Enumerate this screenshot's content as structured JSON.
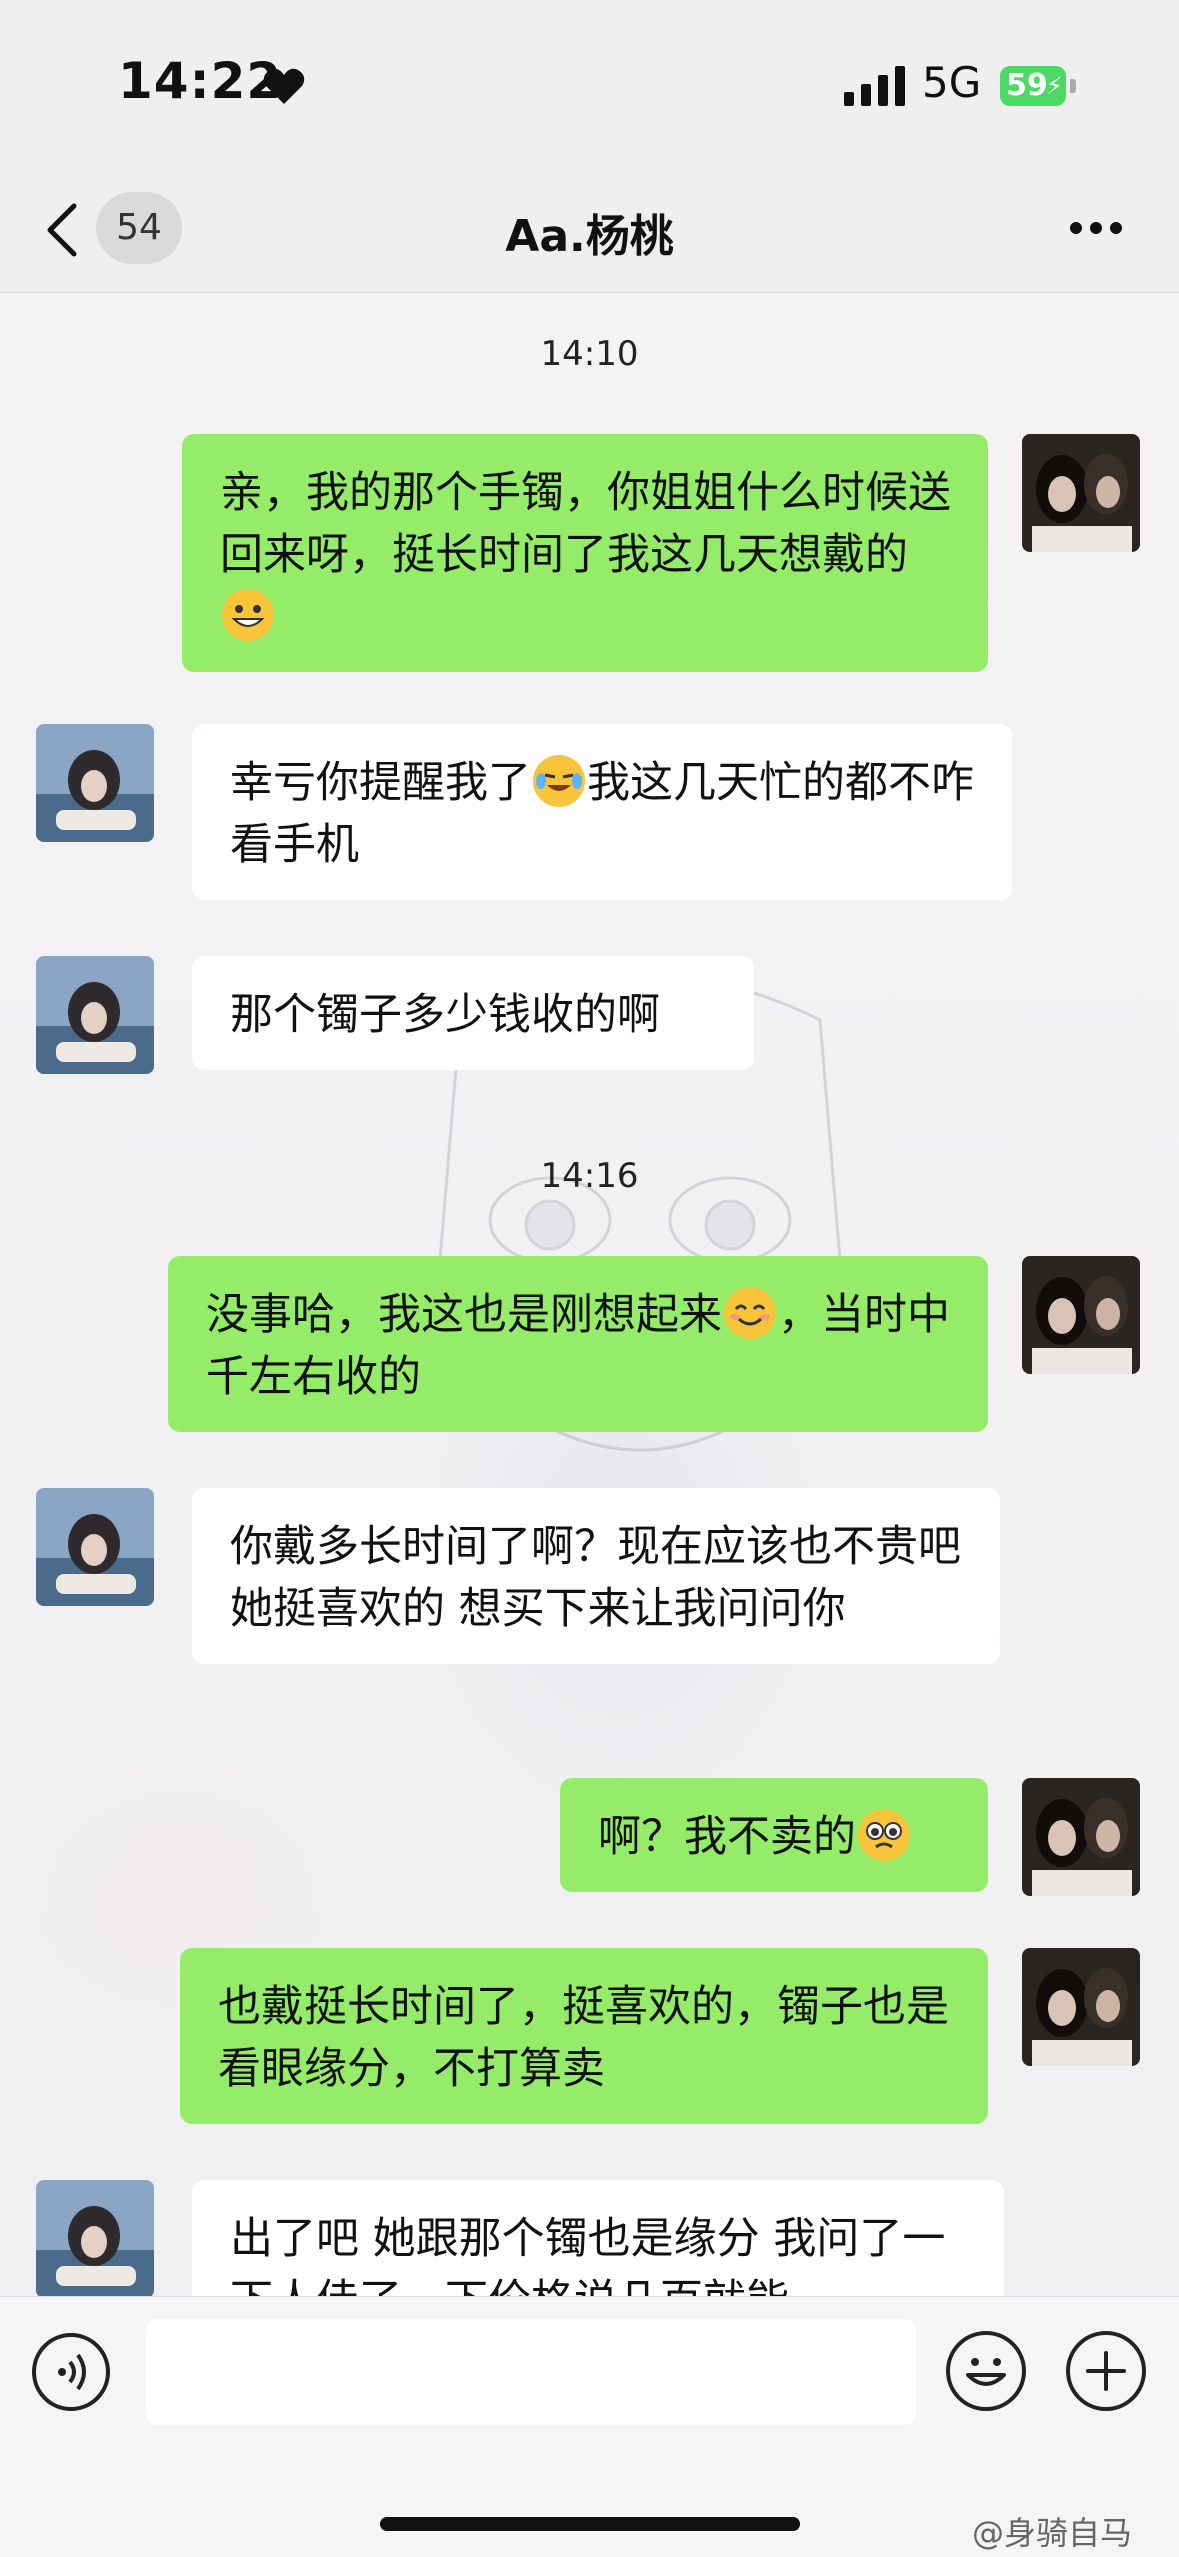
{
  "status_bar": {
    "time": "14:22",
    "network": "5G",
    "battery": "59"
  },
  "nav": {
    "unread_count": "54",
    "title": "Aa.杨桃"
  },
  "timestamps": [
    "14:10",
    "14:16"
  ],
  "messages": [
    {
      "sender": "me",
      "text_a": "亲，我的那个手镯，你姐姐什么时候送回来呀，挺长时间了我这几天想戴的",
      "emoji": "grinning-face"
    },
    {
      "sender": "them",
      "text_a": "幸亏你提醒我了",
      "emoji": "rolling-laughing-face",
      "text_b": "我这几天忙的都不咋看手机"
    },
    {
      "sender": "them",
      "text_a": "那个镯子多少钱收的啊"
    },
    {
      "sender": "me",
      "text_a": "没事哈，我这也是刚想起来",
      "emoji": "smiling-face",
      "text_b": "，当时中千左右收的"
    },
    {
      "sender": "them",
      "text_a": "你戴多长时间了啊？现在应该也不贵吧 她挺喜欢的 想买下来让我问问你"
    },
    {
      "sender": "me",
      "text_a": "啊？我不卖的",
      "emoji": "pleading-face"
    },
    {
      "sender": "me",
      "text_a": "也戴挺长时间了，挺喜欢的，镯子也是看眼缘分，不打算卖"
    },
    {
      "sender": "them",
      "text_a": "出了吧 她跟那个镯也是缘分 我问了一下人佳了一下价格说几百就能"
    }
  ],
  "footer": {
    "watermark": "@身骑自马"
  },
  "colors": {
    "my_bubble": "#95ec69",
    "their_bubble": "#ffffff",
    "battery": "#4cd964"
  }
}
